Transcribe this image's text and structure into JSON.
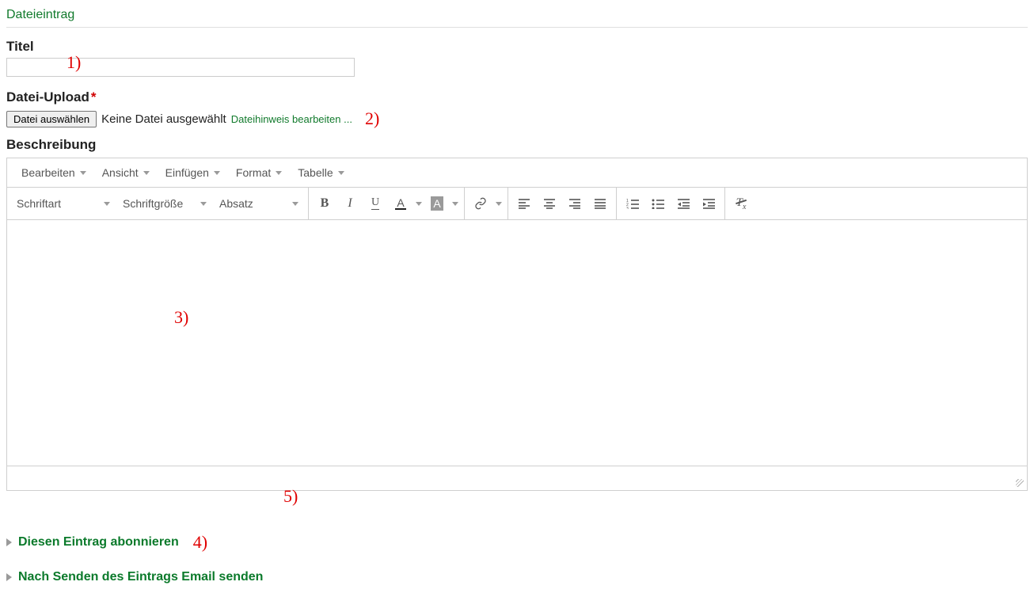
{
  "section_title": "Dateieintrag",
  "labels": {
    "title": "Titel",
    "upload": "Datei-Upload",
    "description": "Beschreibung"
  },
  "upload": {
    "choose_btn": "Datei auswählen",
    "no_file": "Keine Datei ausgewählt",
    "edit_hint": "Dateihinweis bearbeiten ..."
  },
  "editor": {
    "menus": {
      "edit": "Bearbeiten",
      "view": "Ansicht",
      "insert": "Einfügen",
      "format": "Format",
      "table": "Tabelle"
    },
    "selects": {
      "font": "Schriftart",
      "size": "Schriftgröße",
      "block": "Absatz"
    }
  },
  "expanders": {
    "subscribe": "Diesen Eintrag abonnieren",
    "email_after_send": "Nach Senden des Eintrags Email senden"
  },
  "annotations": {
    "a1": "1)",
    "a2": "2)",
    "a3": "3)",
    "a4": "4)",
    "a5": "5)"
  }
}
